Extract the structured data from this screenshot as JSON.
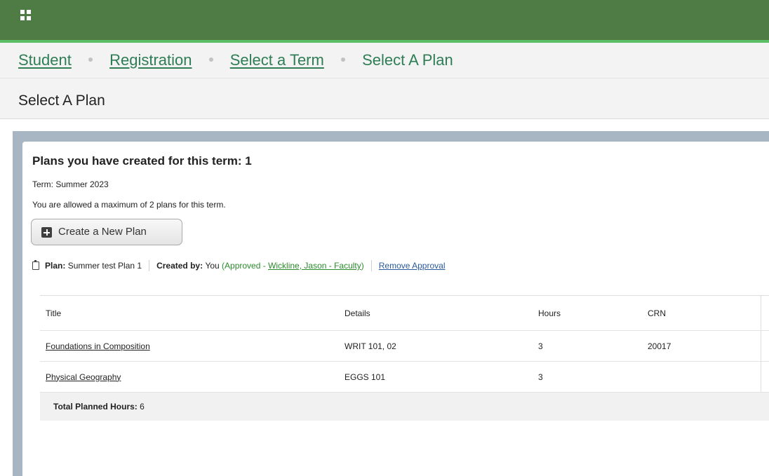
{
  "header": {
    "apps_icon": "apps-grid-icon"
  },
  "breadcrumb": [
    {
      "label": "Student",
      "link": true
    },
    {
      "label": "Registration",
      "link": true
    },
    {
      "label": "Select a Term",
      "link": true
    },
    {
      "label": "Select A Plan",
      "link": false
    }
  ],
  "page_title": "Select A Plan",
  "plans": {
    "heading": "Plans you have created for this term: 1",
    "term": "Term: Summer 2023",
    "max_note": "You are allowed a maximum of 2 plans for this term.",
    "create_button": "Create a New Plan"
  },
  "plan": {
    "plan_label": "Plan:",
    "plan_name": "Summer test Plan 1",
    "created_label": "Created by:",
    "created_by": "You",
    "approved_prefix": "(Approved - ",
    "approver": "Wickline, Jason - Faculty",
    "approved_suffix": ")",
    "remove_approval": "Remove Approval"
  },
  "table": {
    "columns": [
      "Title",
      "Details",
      "Hours",
      "CRN"
    ],
    "rows": [
      {
        "title": "Foundations in Composition",
        "details": "WRIT 101, 02",
        "hours": "3",
        "crn": "20017"
      },
      {
        "title": "Physical Geography",
        "details": "EGGS 101",
        "hours": "3",
        "crn": ""
      }
    ],
    "total_label": "Total Planned Hours:",
    "total_value": "6"
  },
  "colors": {
    "header_green": "#4e7c44",
    "accent_green": "#5cbf65",
    "link_green": "#2e7d55",
    "approved_green": "#2c8a2c",
    "link_blue": "#2a5a9b"
  }
}
